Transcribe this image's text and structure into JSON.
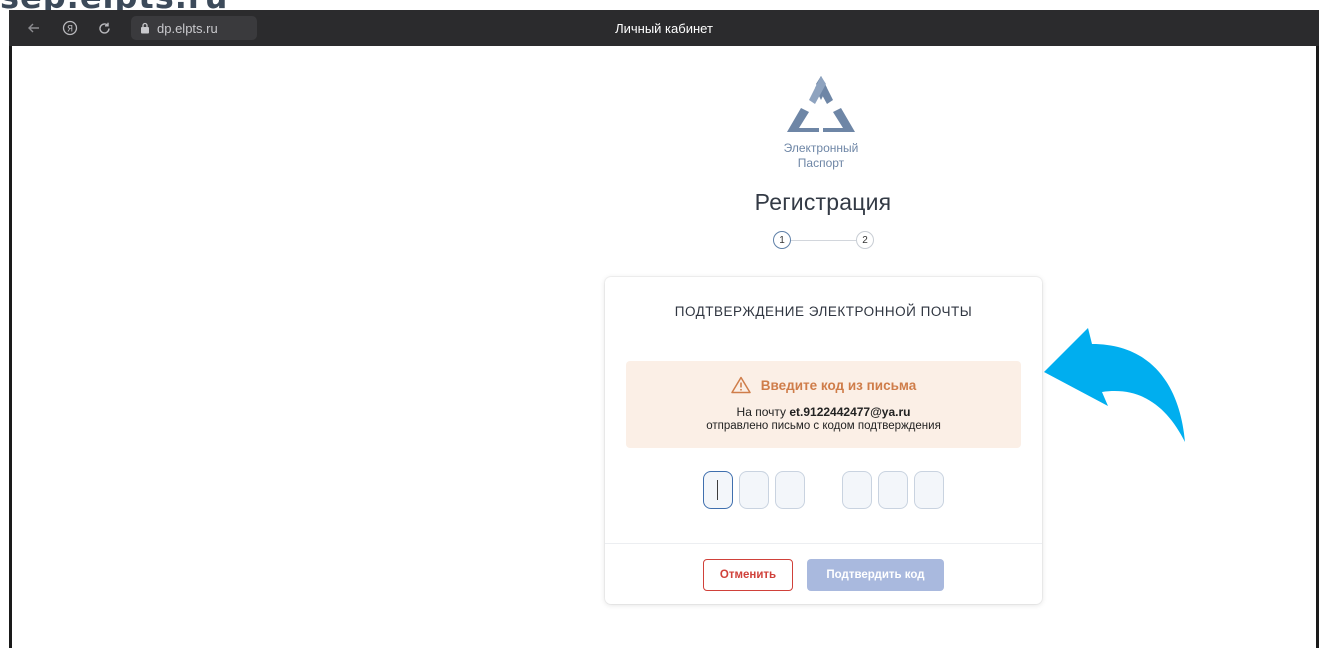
{
  "top_crop_text": "sep.elpts.ru",
  "browser": {
    "url": "dp.elpts.ru",
    "tab_title": "Личный кабинет",
    "icons": [
      "back-arrow-icon",
      "yandex-icon",
      "reload-icon",
      "lock-icon"
    ]
  },
  "logo": {
    "line1": "Электронный",
    "line2": "Паспорт",
    "color": "#6e86a6"
  },
  "page_title": "Регистрация",
  "steps": {
    "step1": "1",
    "step2": "2",
    "current": 1
  },
  "card": {
    "title": "ПОДТВЕРЖДЕНИЕ ЭЛЕКТРОННОЙ ПОЧТЫ",
    "alert": {
      "title": "Введите код из письма",
      "line1_prefix": "На почту ",
      "email": "et.9122442477@ya.ru",
      "line2": "отправлено письмо с кодом подтверждения",
      "accent": "#cf7d4a",
      "background": "#fbefe6"
    },
    "code_digits": [
      "",
      "",
      "",
      "",
      "",
      ""
    ],
    "cancel_label": "Отменить",
    "confirm_label": "Подтвердить код"
  },
  "annotation_arrow_color": "#00aeef"
}
